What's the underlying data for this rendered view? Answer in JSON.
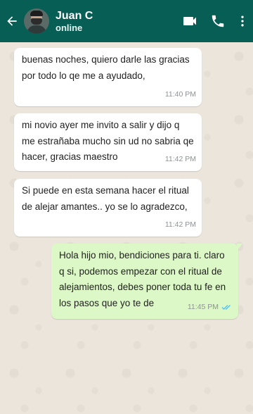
{
  "header": {
    "contact_name": "Juan C",
    "contact_status": "online",
    "colors": {
      "bar": "#075e54"
    },
    "icons": [
      "back-arrow-icon",
      "video-call-icon",
      "phone-icon",
      "more-vert-icon"
    ]
  },
  "messages": [
    {
      "direction": "in",
      "text": "buenas noches, quiero darle las gracias por todo lo qe me a ayudado,",
      "time": "11:40 PM"
    },
    {
      "direction": "in",
      "text": "mi novio ayer me invito a salir y dijo q me estrañaba mucho sin ud no sabria qe hacer, gracias maestro",
      "time": "11:42 PM"
    },
    {
      "direction": "in",
      "text": "Si puede en esta semana hacer el ritual de alejar amantes.. yo se lo agradezco,",
      "time": "11:42 PM"
    },
    {
      "direction": "out",
      "text": "Hola hijo mio, bendiciones para ti. claro q si, podemos empezar con el ritual de alejamientos, debes poner toda tu fe en los pasos que yo te de",
      "time": "11:45 PM",
      "read_icon": "double-check-icon"
    }
  ],
  "colors": {
    "incoming_bubble": "#ffffff",
    "outgoing_bubble": "#dcf8c6",
    "read_ticks": "#4fc3f7"
  }
}
